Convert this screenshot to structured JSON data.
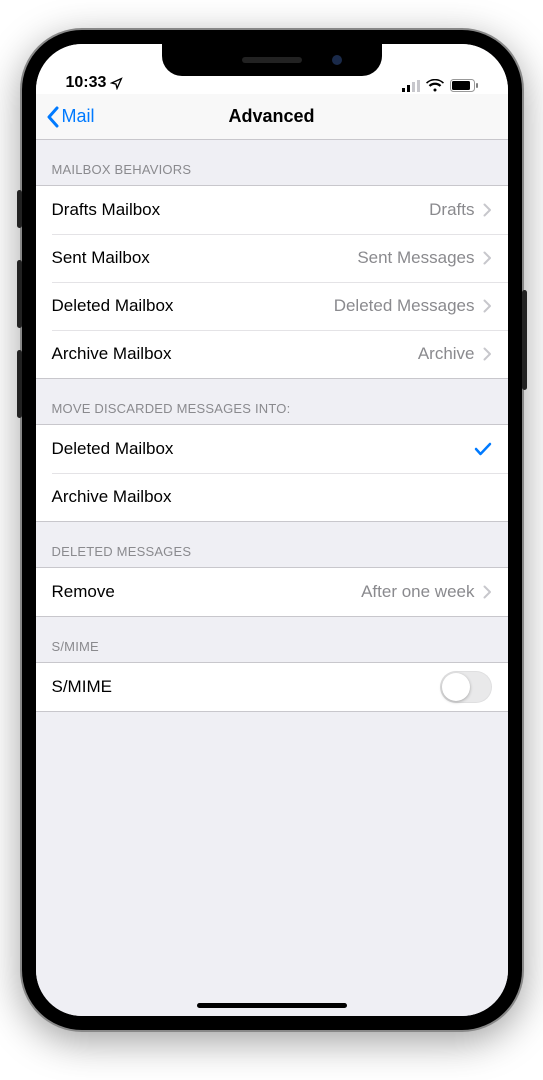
{
  "status": {
    "time": "10:33"
  },
  "nav": {
    "back_label": "Mail",
    "title": "Advanced"
  },
  "sections": {
    "mailbox_behaviors": {
      "header": "MAILBOX BEHAVIORS",
      "drafts_label": "Drafts Mailbox",
      "drafts_value": "Drafts",
      "sent_label": "Sent Mailbox",
      "sent_value": "Sent Messages",
      "deleted_label": "Deleted Mailbox",
      "deleted_value": "Deleted Messages",
      "archive_label": "Archive Mailbox",
      "archive_value": "Archive"
    },
    "move_discarded": {
      "header": "MOVE DISCARDED MESSAGES INTO:",
      "deleted_label": "Deleted Mailbox",
      "archive_label": "Archive Mailbox",
      "selected": "deleted"
    },
    "deleted_messages": {
      "header": "DELETED MESSAGES",
      "remove_label": "Remove",
      "remove_value": "After one week"
    },
    "smime": {
      "header": "S/MIME",
      "label": "S/MIME",
      "enabled": false
    }
  }
}
